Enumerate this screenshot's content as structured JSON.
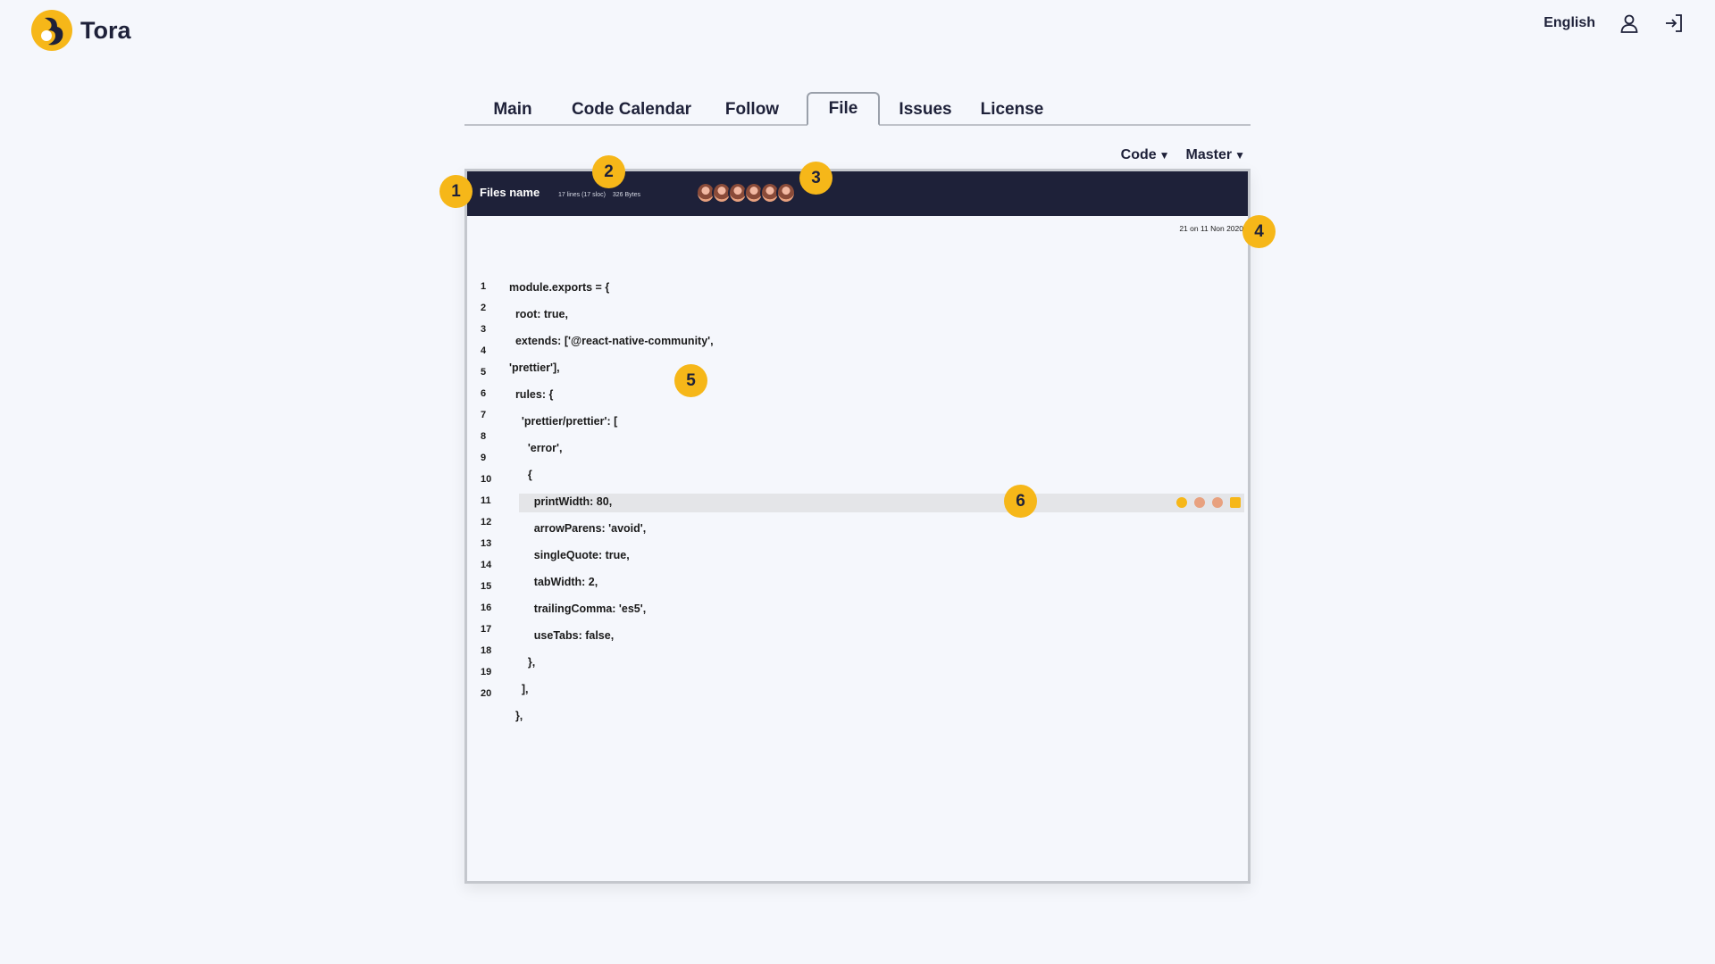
{
  "app": {
    "name": "Tora"
  },
  "header": {
    "language": "English",
    "user_icon": "user-icon",
    "logout_icon": "logout-icon"
  },
  "tabs": [
    {
      "label": "Main"
    },
    {
      "label": "Code Calendar"
    },
    {
      "label": "Follow"
    },
    {
      "label": "File",
      "active": true
    },
    {
      "label": "Issues"
    },
    {
      "label": "License"
    }
  ],
  "selectors": {
    "code": "Code",
    "branch": "Master"
  },
  "file": {
    "name": "Files name",
    "lines": "17 lines (17 sloc)",
    "size": "326 Bytes",
    "contributor_count": 6,
    "date": "21 on 11 Non 2020"
  },
  "line_numbers": [
    "1",
    "2",
    "3",
    "4",
    "5",
    "6",
    "7",
    "8",
    "9",
    "10",
    "11",
    "12",
    "13",
    "14",
    "15",
    "16",
    "17",
    "18",
    "19",
    "20"
  ],
  "code_lines": [
    "module.exports = {",
    "  root: true,",
    "  extends: ['@react-native-community',",
    "'prettier'],",
    "  rules: {",
    "    'prettier/prettier': [",
    "      'error',",
    "      {",
    "        printWidth: 80,",
    "        arrowParens: 'avoid',",
    "        singleQuote: true,",
    "        tabWidth: 2,",
    "        trailingComma: 'es5',",
    "        useTabs: false,",
    "      },",
    "    ],",
    "  },"
  ],
  "highlighted_line_icons": [
    "warning-icon",
    "avatar-icon",
    "avatar-icon",
    "mail-icon"
  ],
  "callouts": [
    "1",
    "2",
    "3",
    "4",
    "5",
    "6"
  ],
  "colors": {
    "accent": "#f6b719",
    "dark": "#1e2139",
    "background": "#f5f7fc",
    "highlight": "#e4e5e8"
  }
}
